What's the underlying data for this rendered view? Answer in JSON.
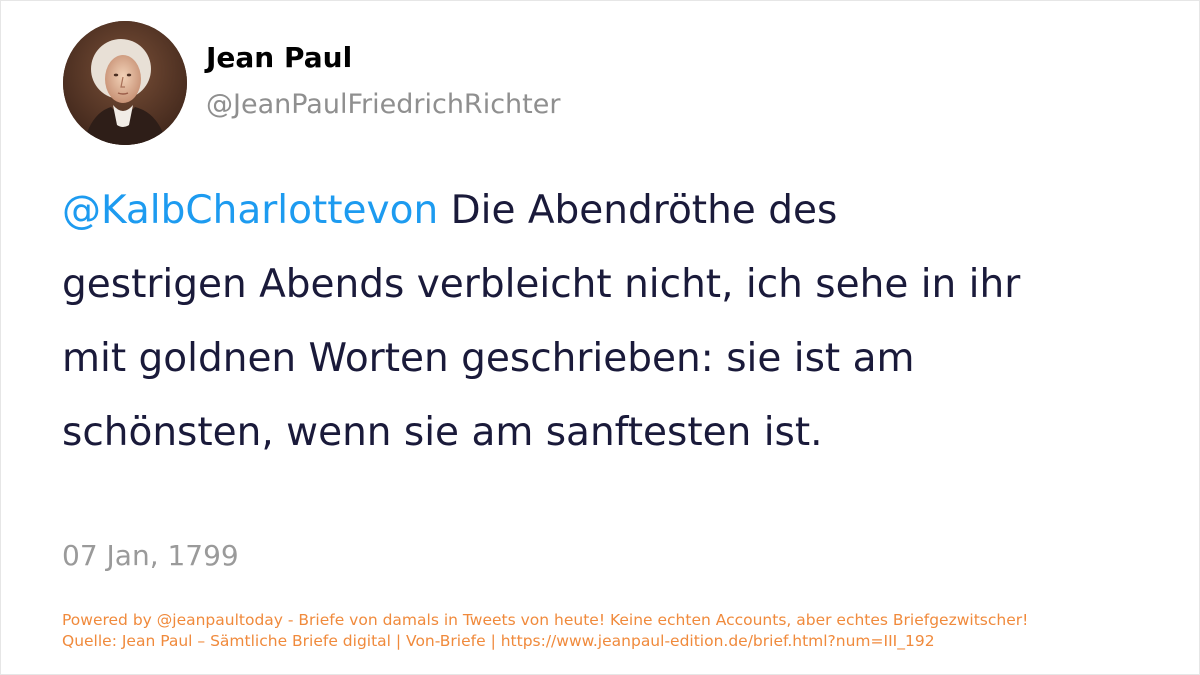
{
  "tweet": {
    "author": {
      "display_name": "Jean Paul",
      "handle": "@JeanPaulFriedrichRichter",
      "avatar_icon": "portrait-avatar"
    },
    "text": {
      "mention": "@KalbCharlottevon",
      "line1_rest": " Die Abendröthe des",
      "line2": "gestrigen Abends verbleicht nicht, ich sehe in ihr",
      "line3": "mit goldnen Worten geschrieben: sie ist am",
      "line4": "schönsten, wenn sie am sanftesten ist."
    },
    "timestamp": "07 Jan, 1799"
  },
  "footer": {
    "powered_by": "Powered by @jeanpaultoday - Briefe von damals in Tweets von heute! Keine echten Accounts, aber echtes Briefgezwitscher!",
    "source": "Quelle: Jean Paul – Sämtliche Briefe digital | Von-Briefe | https://www.jeanpaul-edition.de/brief.html?num=III_192"
  },
  "colors": {
    "mention": "#1d9bf0",
    "text": "#1a1a3a",
    "muted": "#9a9a9a",
    "footer": "#f08a3c"
  }
}
